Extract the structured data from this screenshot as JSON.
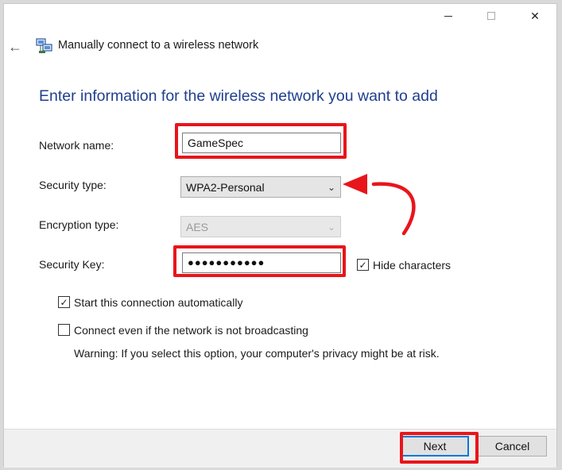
{
  "window": {
    "title": "Manually connect to a wireless network",
    "minimize_icon": "minimize-icon",
    "maximize_icon": "maximize-icon",
    "close_glyph": "✕",
    "back_glyph": "←",
    "app_icon": "network-computers-icon"
  },
  "heading": "Enter information for the wireless network you want to add",
  "form": {
    "network_name_label": "Network name:",
    "network_name_value": "GameSpec",
    "security_type_label": "Security type:",
    "security_type_value": "WPA2-Personal",
    "encryption_type_label": "Encryption type:",
    "encryption_type_value": "AES",
    "security_key_label": "Security Key:",
    "security_key_value": "●●●●●●●●●●●",
    "hide_characters_label": "Hide characters",
    "hide_characters_checked": true
  },
  "options": {
    "auto_start_label": "Start this connection automatically",
    "auto_start_checked": true,
    "connect_hidden_label": "Connect even if the network is not broadcasting",
    "connect_hidden_checked": false,
    "warning": "Warning: If you select this option, your computer's privacy might be at risk."
  },
  "footer": {
    "next_label": "Next",
    "cancel_label": "Cancel"
  },
  "annotation_color": "#e8151b"
}
